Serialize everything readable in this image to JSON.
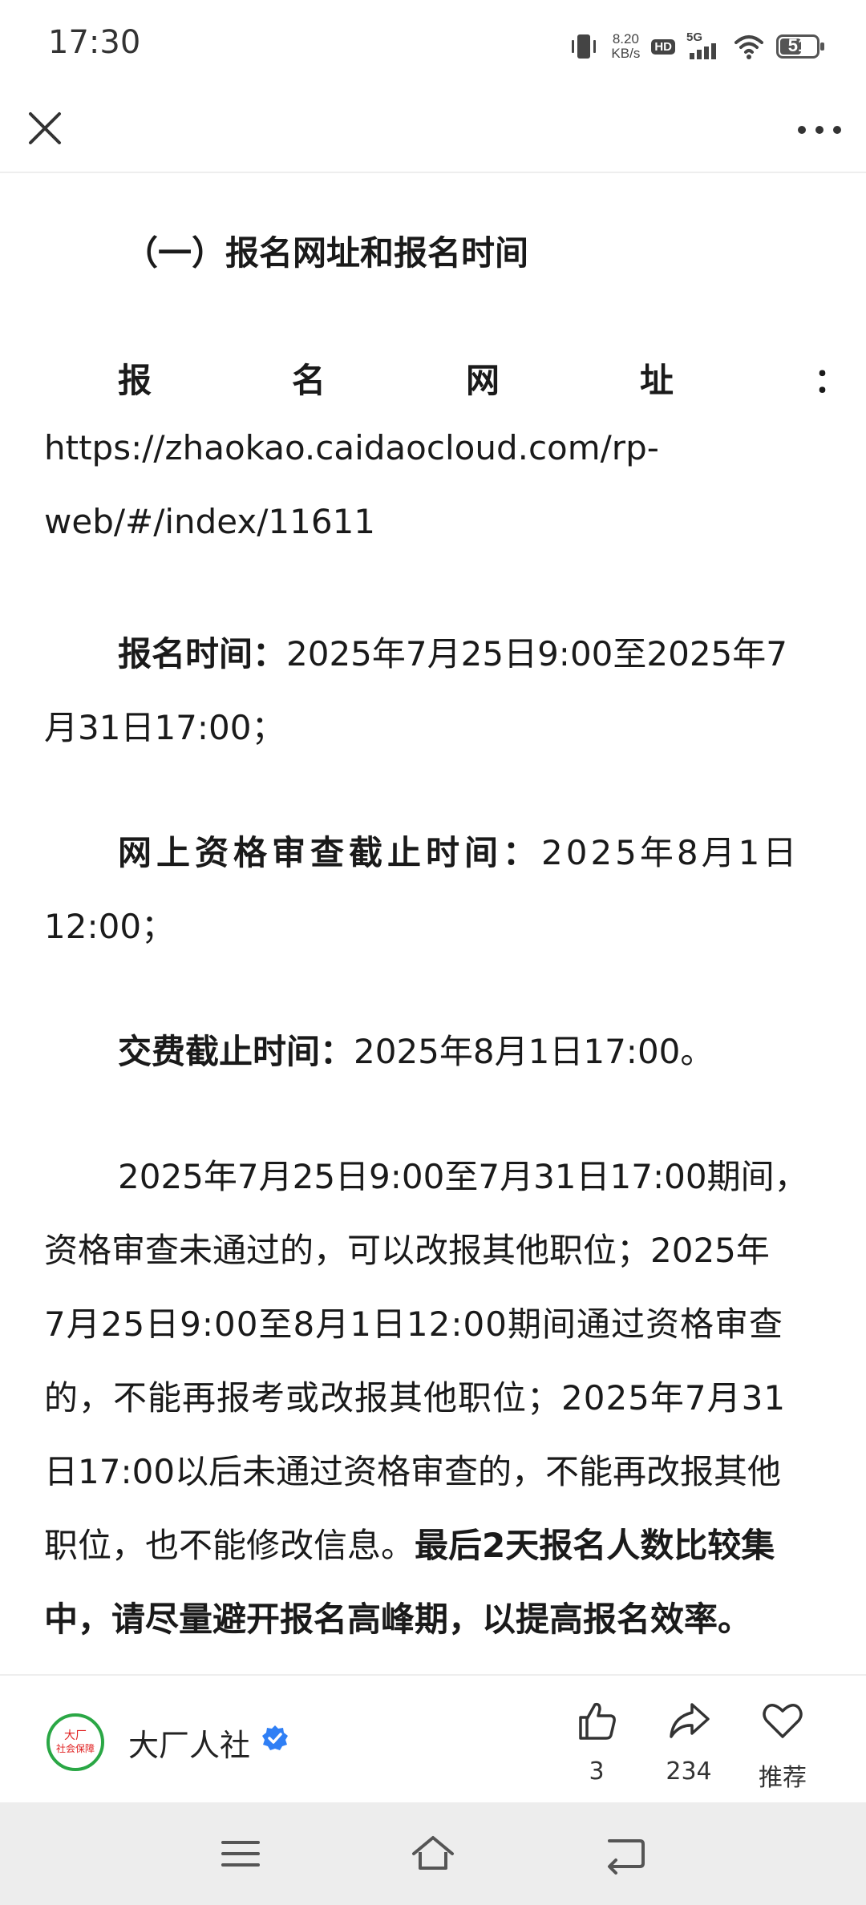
{
  "status_bar": {
    "time": "17:30",
    "net_speed_value": "8.20",
    "net_speed_unit": "KB/s",
    "hd_label": "HD",
    "network_type": "5G",
    "battery_level": "51",
    "icons": [
      "vibrate-icon",
      "hd-icon",
      "signal-icon",
      "wifi-icon",
      "battery-icon"
    ]
  },
  "top_nav": {
    "icons": [
      "close-icon",
      "more-icon"
    ]
  },
  "article": {
    "section_heading": "（一）报名网址和报名时间",
    "url_label_chars": [
      "报",
      "名",
      "网",
      "址",
      "："
    ],
    "url_line_1": "https://zhaokao.caidaocloud.com/rp-",
    "url_line_2": "web/#/index/11611",
    "reg_time_label": "报名时间：",
    "reg_time_value_1": "2025年7月25日9:00至2025年7",
    "reg_time_value_2": "月31日17:00；",
    "review_label": "网上资格审查截止时间：",
    "review_value_1": "2025年8月1日",
    "review_value_2": "12:00；",
    "fee_label": "交费截止时间：",
    "fee_value": "2025年8月1日17:00。",
    "para_line_1": "2025年7月25日9:00至7月31日17:00期间，",
    "para_line_2": "资格审查未通过的，可以改报其他职位；2025年",
    "para_line_3": "7月25日9:00至8月1日12:00期间通过资格审查",
    "para_line_4": "的，不能再报考或改报其他职位；2025年7月31",
    "para_line_5": "日17:00以后未通过资格审查的，不能再改报其他",
    "para_line_6a": "职位，也不能修改信息。",
    "para_line_6b": "最后2天报名人数比较集",
    "para_line_7": "中，请尽量避开报名高峰期，以提高报名效率。"
  },
  "action_bar": {
    "author_name": "大厂人社",
    "logo_text_top": "大厂",
    "logo_text_bottom": "社会保障",
    "likes_count": "3",
    "shares_count": "234",
    "recommend_label": "推荐",
    "icons": [
      "thumbs-up-icon",
      "share-icon",
      "heart-icon",
      "verified-icon"
    ]
  },
  "system_nav": {
    "icons": [
      "menu-icon",
      "home-icon",
      "back-icon"
    ]
  },
  "colors": {
    "logo_green": "#2aa745",
    "logo_red": "#e02020",
    "verified_blue": "#2f7ff5",
    "nav_bg": "#ededed"
  }
}
